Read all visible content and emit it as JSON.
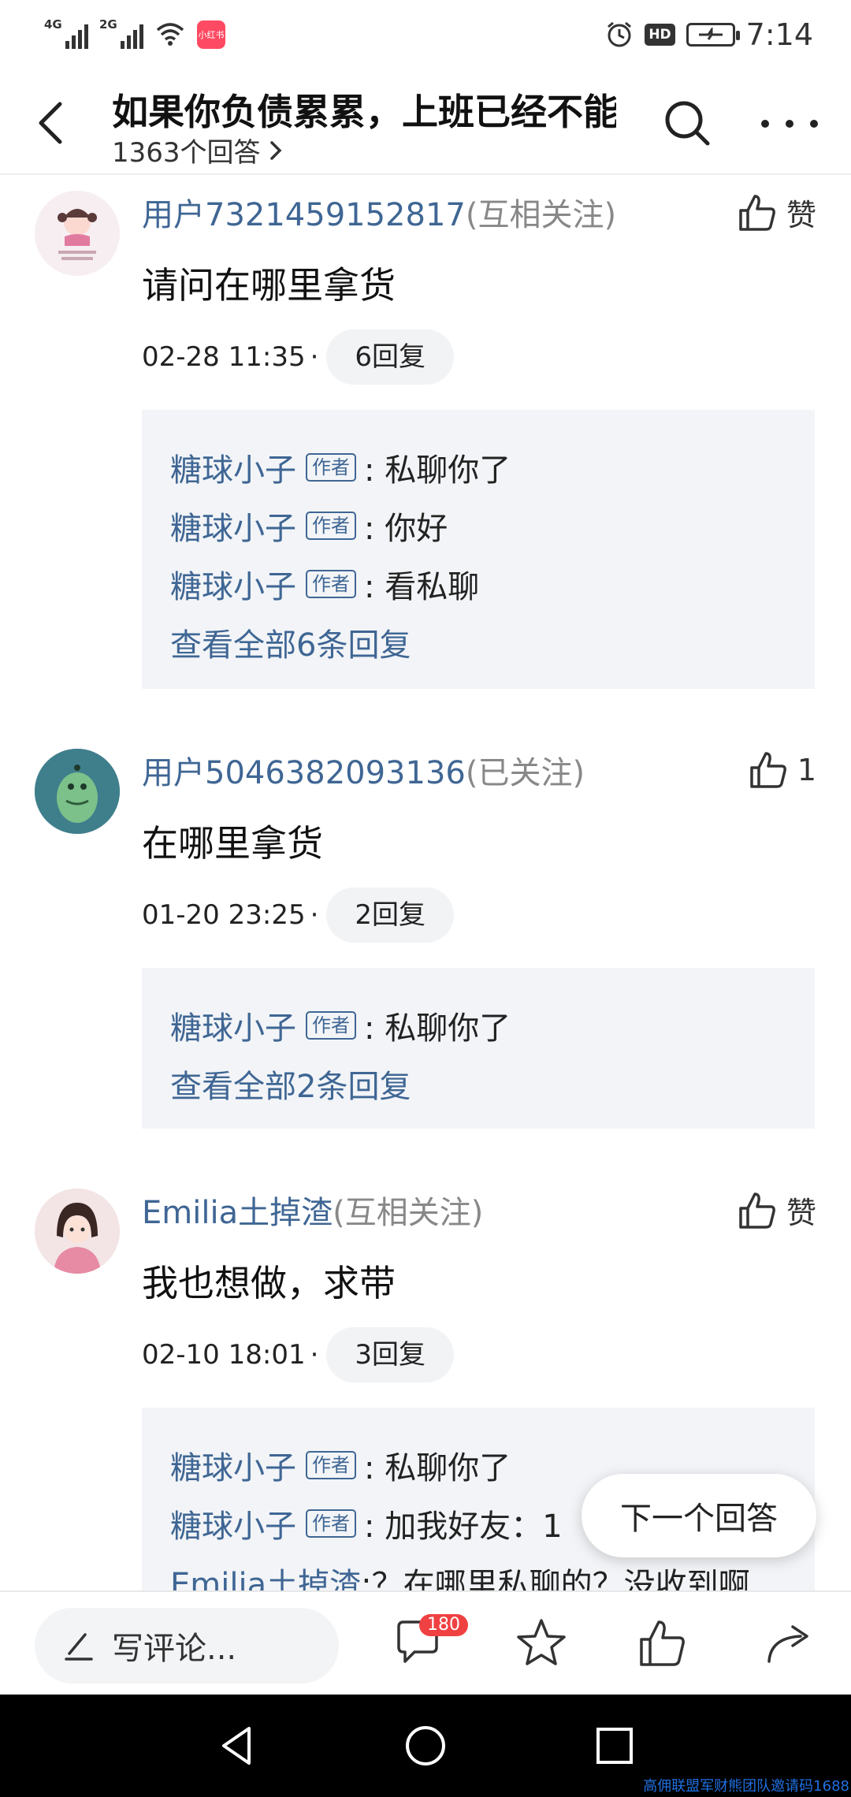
{
  "status_bar": {
    "network_1": "4G",
    "network_2": "2G",
    "app_badge": "小红书",
    "hd": "HD",
    "time": "7:14"
  },
  "header": {
    "title": "如果你负债累累，上班已经不能…",
    "answers_count": "1363个回答",
    "icons": [
      "back-arrow-icon",
      "search-icon",
      "more-icon"
    ]
  },
  "comments": [
    {
      "user": "用户7321459152817",
      "follow": "(互相关注)",
      "like_label": "赞",
      "text": "请问在哪里拿货",
      "date": "02-28 11:35",
      "dot": "·",
      "reply_count": "6回复",
      "replies": [
        {
          "name": "糖球小子",
          "tag": "作者",
          "text": ": 私聊你了"
        },
        {
          "name": "糖球小子",
          "tag": "作者",
          "text": ": 你好"
        },
        {
          "name": "糖球小子",
          "tag": "作者",
          "text": ": 看私聊"
        }
      ],
      "view_all": "查看全部6条回复"
    },
    {
      "user": "用户5046382093136",
      "follow": "(已关注)",
      "like_label": "1",
      "text": "在哪里拿货",
      "date": "01-20 23:25",
      "dot": "·",
      "reply_count": "2回复",
      "replies": [
        {
          "name": "糖球小子",
          "tag": "作者",
          "text": ": 私聊你了"
        }
      ],
      "view_all": "查看全部2条回复"
    },
    {
      "user": "Emilia土掉渣",
      "follow": "(互相关注)",
      "like_label": "赞",
      "text": "我也想做，求带",
      "date": "02-10 18:01",
      "dot": "·",
      "reply_count": "3回复",
      "replies": [
        {
          "name": "糖球小子",
          "tag": "作者",
          "text": ": 私聊你了"
        },
        {
          "name": "糖球小子",
          "tag": "作者",
          "text": ": 加我好友：1"
        },
        {
          "name": "Emilia土掉渣",
          "tag": "",
          "text": ":？在哪里私聊的？没收到啊"
        }
      ]
    }
  ],
  "next_answer": "下一个回答",
  "action_bar": {
    "write_placeholder": "写评论...",
    "comment_count": "180"
  },
  "watermark": "高佣联盟军财熊团队邀请码1688"
}
